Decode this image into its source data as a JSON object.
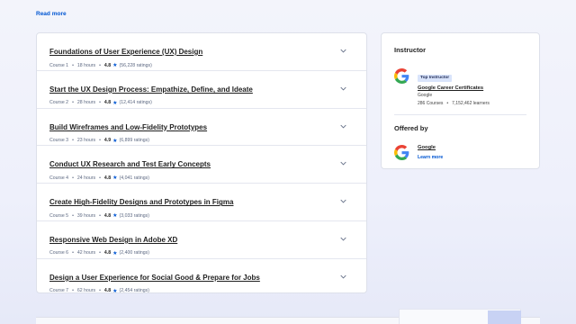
{
  "read_more": "Read more",
  "courses": [
    {
      "title": "Foundations of User Experience (UX) Design",
      "course": "Course 1",
      "hours": "18 hours",
      "rating": "4.8",
      "ratings": "(56,228 ratings)"
    },
    {
      "title": "Start the UX Design Process: Empathize, Define, and Ideate",
      "course": "Course 2",
      "hours": "28 hours",
      "rating": "4.8",
      "ratings": "(12,414 ratings)"
    },
    {
      "title": "Build Wireframes and Low-Fidelity Prototypes",
      "course": "Course 3",
      "hours": "23 hours",
      "rating": "4.9",
      "ratings": "(6,899 ratings)"
    },
    {
      "title": "Conduct UX Research and Test Early Concepts",
      "course": "Course 4",
      "hours": "24 hours",
      "rating": "4.8",
      "ratings": "(4,041 ratings)"
    },
    {
      "title": "Create High-Fidelity Designs and Prototypes in Figma",
      "course": "Course 5",
      "hours": "39 hours",
      "rating": "4.8",
      "ratings": "(3,033 ratings)"
    },
    {
      "title": "Responsive Web Design in Adobe XD",
      "course": "Course 6",
      "hours": "42 hours",
      "rating": "4.8",
      "ratings": "(2,400 ratings)"
    },
    {
      "title": "Design a User Experience for Social Good & Prepare for Jobs",
      "course": "Course 7",
      "hours": "62 hours",
      "rating": "4.8",
      "ratings": "(2,454 ratings)"
    }
  ],
  "instructor": {
    "heading": "Instructor",
    "badge": "Top Instructor",
    "name": "Google Career Certificates",
    "org": "Google",
    "courses": "286 Courses",
    "learners": "7,152,462 learners"
  },
  "offered_by": {
    "heading": "Offered by",
    "name": "Google",
    "learn_more": "Learn more"
  },
  "colors": {
    "accent": "#0056d2",
    "badge_bg": "#d9e4fb"
  }
}
